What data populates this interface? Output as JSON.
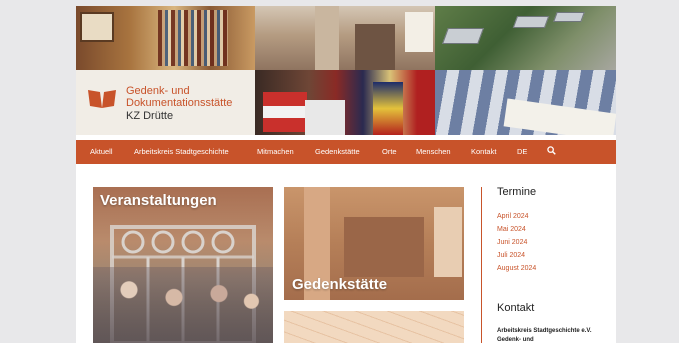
{
  "logo": {
    "line1": "Gedenk- und",
    "line2": "Dokumentationsstätte",
    "line3": "KZ Drütte",
    "color": "#c8532a"
  },
  "nav": {
    "items": [
      "Aktuell",
      "Arbeitskreis Stadtgeschichte",
      "Mitmachen",
      "Gedenkstätte",
      "Orte",
      "Menschen",
      "Kontakt",
      "DE"
    ],
    "search_icon": "search-icon",
    "background": "#c8532a"
  },
  "tiles": {
    "veranstaltungen": "Veranstaltungen",
    "gedenkstaette": "Gedenkstätte"
  },
  "sidebar": {
    "termine_title": "Termine",
    "termine": [
      "April 2024",
      "Mai 2024",
      "Juni 2024",
      "Juli 2024",
      "August 2024"
    ],
    "kontakt_title": "Kontakt",
    "kontakt_line1": "Arbeitskreis Stadtgeschichte e.V.",
    "kontakt_line2": "Gedenk- und"
  }
}
